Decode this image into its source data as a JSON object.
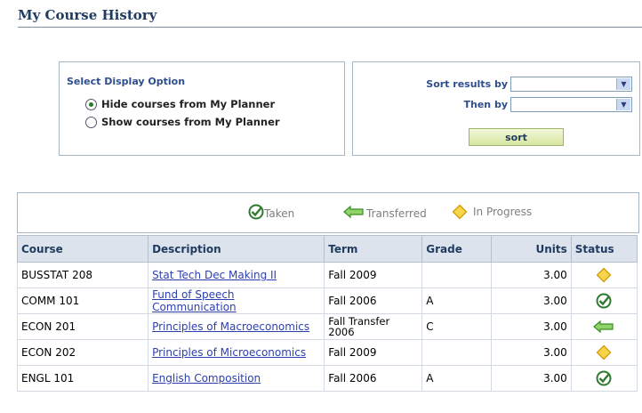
{
  "page_title": "My Course History",
  "display_options": {
    "label": "Select Display Option",
    "options": [
      {
        "label": "Hide courses from My Planner",
        "selected": true
      },
      {
        "label": "Show courses from My Planner",
        "selected": false
      }
    ]
  },
  "sort_panel": {
    "sort_label": "Sort results by",
    "then_label": "Then by",
    "sort_value": "",
    "then_value": "",
    "button_label": "sort"
  },
  "legend": [
    {
      "icon": "taken-check-icon",
      "label": "Taken"
    },
    {
      "icon": "transferred-arrow-icon",
      "label": "Transferred"
    },
    {
      "icon": "in-progress-diamond-icon",
      "label": "In Progress"
    }
  ],
  "table": {
    "headers": [
      "Course",
      "Description",
      "Term",
      "Grade",
      "Units",
      "Status"
    ],
    "rows": [
      {
        "course": "BUSSTAT 208",
        "description": "Stat Tech Dec Making II",
        "term": "Fall 2009",
        "grade": "",
        "units": "3.00",
        "status": "In Progress"
      },
      {
        "course": "COMM 101",
        "description": "Fund of Speech Communication",
        "term": "Fall 2006",
        "grade": "A",
        "units": "3.00",
        "status": "Taken"
      },
      {
        "course": "ECON 201",
        "description": "Principles of Macroeconomics",
        "term": "Fall Transfer 2006",
        "grade": "C",
        "units": "3.00",
        "status": "Transferred"
      },
      {
        "course": "ECON 202",
        "description": "Principles of Microeconomics",
        "term": "Fall 2009",
        "grade": "",
        "units": "3.00",
        "status": "In Progress"
      },
      {
        "course": "ENGL 101",
        "description": "English Composition",
        "term": "Fall 2006",
        "grade": "A",
        "units": "3.00",
        "status": "Taken"
      }
    ]
  },
  "colors": {
    "taken": "#2f7a2f",
    "transferred": "#4ea82a",
    "in_progress": "#f2c41a",
    "link": "#2c3fb0",
    "title": "#1f3b5f"
  }
}
